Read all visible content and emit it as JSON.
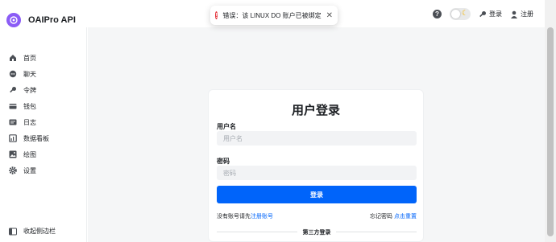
{
  "app": {
    "name": "OAIPro API"
  },
  "header": {
    "help_symbol": "?",
    "login_label": "登录",
    "register_label": "注册"
  },
  "toast": {
    "type": "error",
    "message": "错误：该 LINUX DO 账户已被绑定",
    "close_symbol": "✕"
  },
  "sidebar": {
    "items": [
      {
        "label": "首页",
        "icon": "home-icon"
      },
      {
        "label": "聊天",
        "icon": "chat-icon"
      },
      {
        "label": "令牌",
        "icon": "key-icon"
      },
      {
        "label": "钱包",
        "icon": "wallet-icon"
      },
      {
        "label": "日志",
        "icon": "log-icon"
      },
      {
        "label": "数据看板",
        "icon": "dashboard-icon"
      },
      {
        "label": "绘图",
        "icon": "image-icon"
      },
      {
        "label": "设置",
        "icon": "gear-icon"
      }
    ],
    "collapse_label": "收起侧边栏"
  },
  "login": {
    "title": "用户登录",
    "username_label": "用户名",
    "username_placeholder": "用户名",
    "password_label": "密码",
    "password_placeholder": "密码",
    "submit_label": "登录",
    "no_account_text": "没有账号请先",
    "register_link": "注册账号",
    "forgot_text": "忘记密码",
    "reset_link": "点击重置",
    "third_party_label": "第三方登录"
  },
  "colors": {
    "primary": "#0064fa",
    "error": "#e5333b",
    "logo": "#8b5cf6",
    "background": "#f5f6f7"
  }
}
